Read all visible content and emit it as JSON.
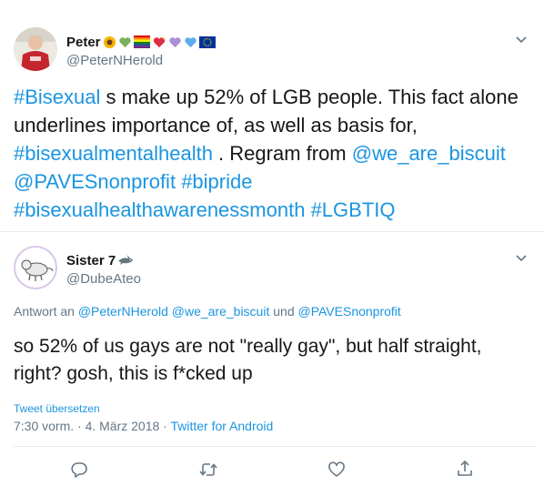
{
  "tweet1": {
    "name": "Peter",
    "name_emojis": [
      "sunflower-icon",
      "green-heart-icon",
      "rainbow-flag-icon",
      "sparkling-heart-icon",
      "purple-heart-icon",
      "blue-heart-icon",
      "eu-flag-icon"
    ],
    "handle": "@PeterNHerold",
    "text": {
      "t1": "#Bisexual",
      "t2": " s make up 52% of LGB people. This fact alone",
      "t3": "underlines importance of, as well as basis for,",
      "t4": "#bisexualmentalhealth",
      "t5": " . Regram from ",
      "t6": "@we_are_biscuit",
      "t7": "@PAVESnonprofit",
      "t8": " ",
      "t9": "#bipride",
      "t10": "#bisexualhealthawarenessmonth",
      "t11": " ",
      "t12": "#LGBTIQ"
    }
  },
  "tweet2": {
    "name": "Sister 7",
    "name_emoji": "shark-icon",
    "handle": "@DubeAteo",
    "reply_prefix": "Antwort an ",
    "reply_user1": "@PeterNHerold",
    "reply_space1": " ",
    "reply_user2": "@we_are_biscuit",
    "reply_and": " und ",
    "reply_user3": "@PAVESnonprofit",
    "text_line1": "so 52% of us gays are not \"really gay\", but half straight,",
    "text_line2": "right? gosh, this is f*cked up",
    "translate": "Tweet übersetzen",
    "time": "7:30 vorm. · 4. März 2018 · ",
    "source": "Twitter for Android"
  },
  "actions": [
    "reply-icon",
    "retweet-icon",
    "like-icon",
    "share-icon"
  ],
  "colors": {
    "link": "#1b95e0",
    "secondary": "#657786",
    "text": "#14171a",
    "divider": "#e6ecf0"
  }
}
